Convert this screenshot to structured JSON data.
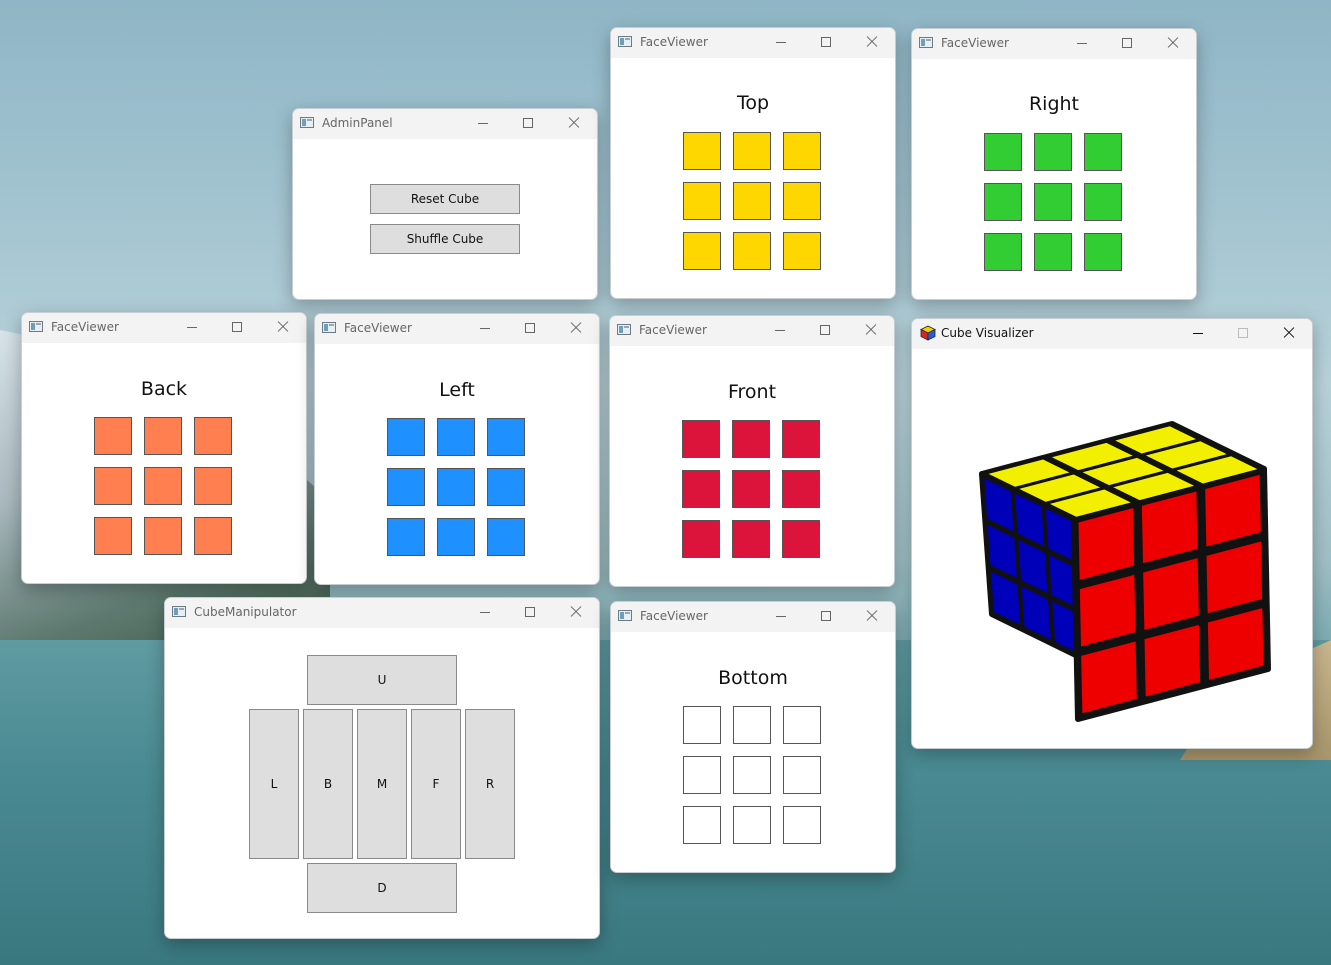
{
  "colors": {
    "top": "#ffd700",
    "right": "#32cd32",
    "back": "#ff7f50",
    "left": "#1e90ff",
    "front": "#dc143c",
    "bottom": "#ffffff"
  },
  "icons": {
    "app_icon": "window-app-icon",
    "visualizer_icon": "rubiks-cube-icon"
  },
  "admin_panel": {
    "title": "AdminPanel",
    "reset_label": "Reset Cube",
    "shuffle_label": "Shuffle Cube"
  },
  "faces": {
    "window_title": "FaceViewer",
    "top": "Top",
    "right": "Right",
    "back": "Back",
    "left": "Left",
    "front": "Front",
    "bottom": "Bottom"
  },
  "visualizer": {
    "title": "Cube Visualizer",
    "cube_face_colors": {
      "top": "#f2f000",
      "front": "#ee0000",
      "left": "#0000b8"
    }
  },
  "manipulator": {
    "title": "CubeManipulator",
    "buttons": {
      "u": "U",
      "l": "L",
      "b": "B",
      "m": "M",
      "f": "F",
      "r": "R",
      "d": "D"
    }
  }
}
